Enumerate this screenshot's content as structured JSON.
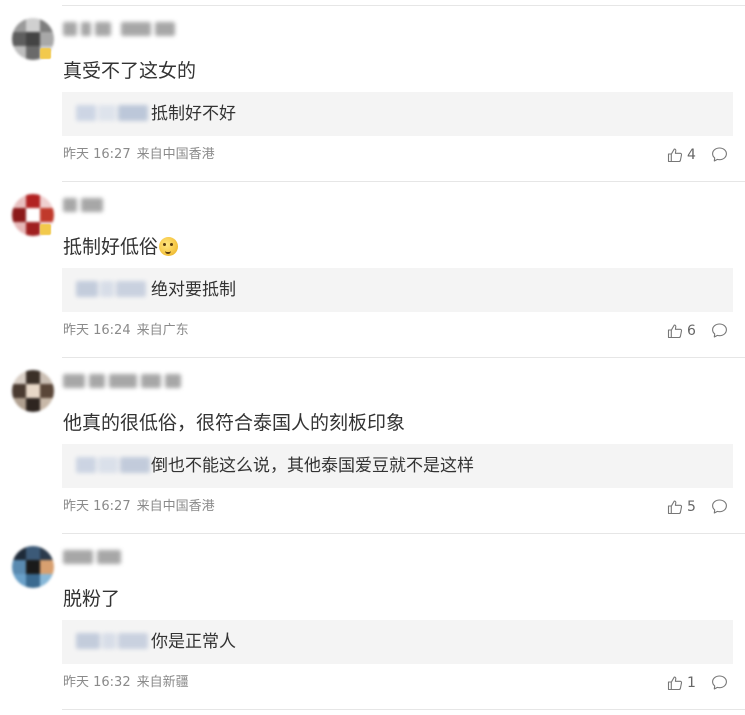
{
  "comments": [
    {
      "text": "真受不了这女的",
      "reply_text": "抵制好不好",
      "time": "昨天 16:27",
      "location": "来自中国香港",
      "likes": "4"
    },
    {
      "text": "抵制好低俗",
      "emoji_icon": "thinking-face-emoji",
      "reply_text": "绝对要抵制",
      "time": "昨天 16:24",
      "location": "来自广东",
      "likes": "6"
    },
    {
      "text": "他真的很低俗，很符合泰国人的刻板印象",
      "reply_text": "倒也不能这么说，其他泰国爱豆就不是这样",
      "time": "昨天 16:27",
      "location": "来自中国香港",
      "likes": "5"
    },
    {
      "text": "脱粉了",
      "reply_text": "你是正常人",
      "time": "昨天 16:32",
      "location": "来自新疆",
      "likes": "1"
    }
  ],
  "icons": {
    "like": "thumbs-up-icon",
    "reply": "comment-bubble-icon"
  },
  "colors": {
    "text": "#333333",
    "meta": "#8a8a8a",
    "reply_bg": "#f4f4f4",
    "divider": "#e6e6e6"
  }
}
